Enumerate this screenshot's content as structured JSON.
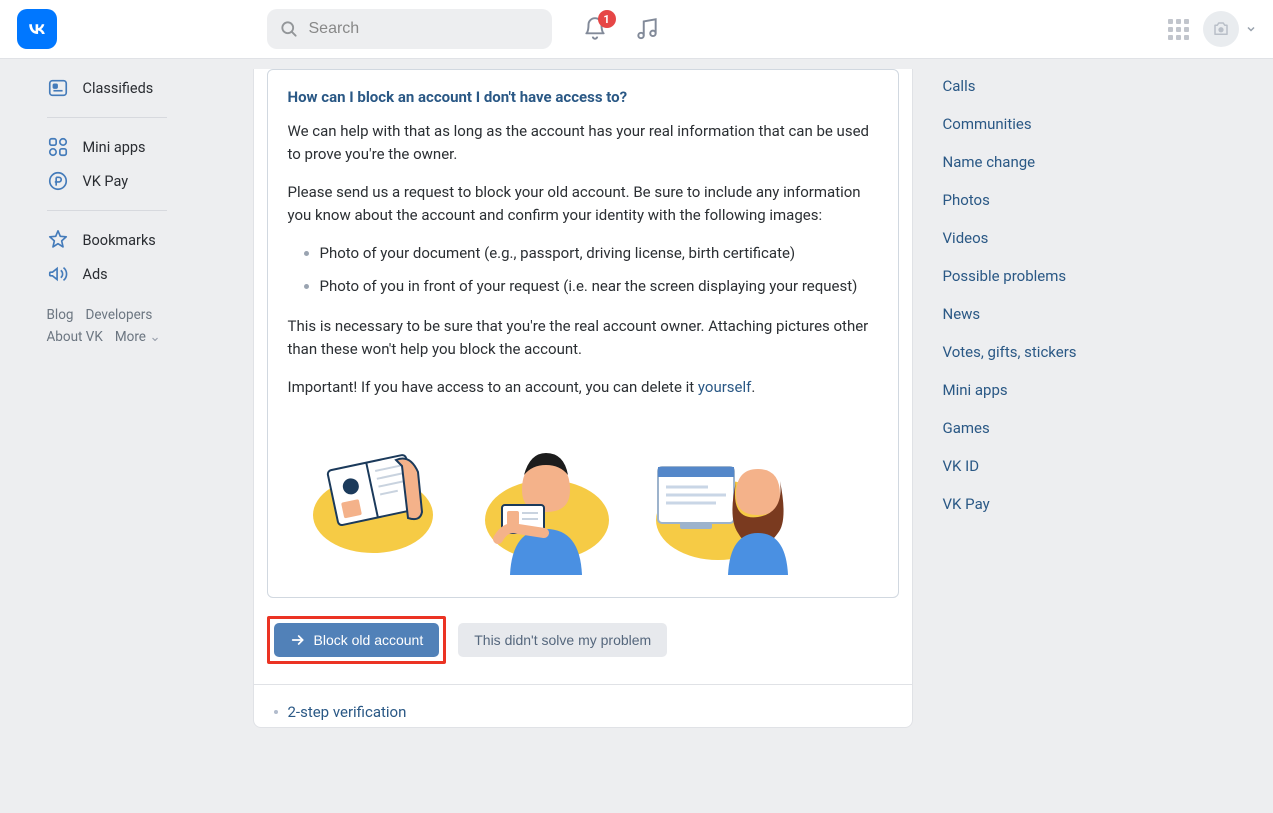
{
  "header": {
    "search_placeholder": "Search",
    "notification_count": "1"
  },
  "sidebar": {
    "nav1": [
      {
        "label": "Classifieds",
        "id": "classifieds"
      }
    ],
    "nav2": [
      {
        "label": "Mini apps",
        "id": "mini-apps"
      },
      {
        "label": "VK Pay",
        "id": "vk-pay"
      }
    ],
    "nav3": [
      {
        "label": "Bookmarks",
        "id": "bookmarks"
      },
      {
        "label": "Ads",
        "id": "ads"
      }
    ],
    "footer": {
      "blog": "Blog",
      "developers": "Developers",
      "about": "About VK",
      "more": "More"
    }
  },
  "faq": {
    "title": "How can I block an account I don't have access to?",
    "p1": "We can help with that as long as the account has your real information that can be used to prove you're the owner.",
    "p2": "Please send us a request to block your old account. Be sure to include any information you know about the account and confirm your identity with the following images:",
    "li1": "Photo of your document (e.g., passport, driving license, birth certificate)",
    "li2": "Photo of you in front of your request (i.e. near the screen displaying your request)",
    "p3": "This is necessary to be sure that you're the real account owner. Attaching pictures other than these won't help you block the account.",
    "p4_a": "Important! If you have access to an account, you can delete it ",
    "p4_link": "yourself",
    "p4_b": ".",
    "btn_primary": "Block old account",
    "btn_secondary": "This didn't solve my problem"
  },
  "sublinks": {
    "twostep": "2-step verification"
  },
  "rightcol": {
    "items": [
      "Calls",
      "Communities",
      "Name change",
      "Photos",
      "Videos",
      "Possible problems",
      "News",
      "Votes, gifts, stickers",
      "Mini apps",
      "Games",
      "VK ID",
      "VK Pay"
    ]
  }
}
